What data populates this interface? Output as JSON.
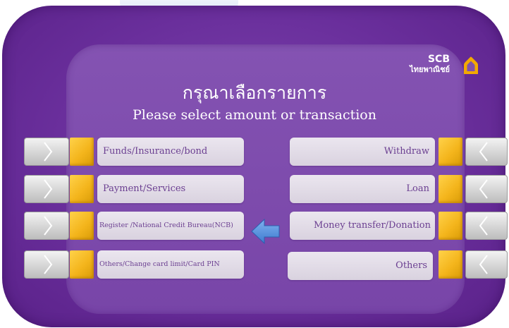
{
  "logo": {
    "brand": "SCB",
    "thai_name": "ไทยพาณิชย์",
    "icon": "scb-house-icon",
    "color": "#f2a900"
  },
  "header": {
    "title_th": "กรุณาเลือกรายการ",
    "title_en": "Please select amount or transaction"
  },
  "colors": {
    "frame": "#6a2f9c",
    "screen": "#7e4dae",
    "accent": "#f4b51c",
    "button_text": "#6b3f91"
  },
  "left_options": [
    {
      "label": "Funds/Insurance/bond"
    },
    {
      "label": "Payment/Services"
    },
    {
      "label": "Register /National Credit Bureau(NCB)"
    },
    {
      "label": "Others/Change card limit/Card PIN"
    }
  ],
  "right_options": [
    {
      "label": "Withdraw"
    },
    {
      "label": "Loan"
    },
    {
      "label": "Money transfer/Donation"
    },
    {
      "label": "Others"
    }
  ],
  "pointer": {
    "icon": "blue-left-arrow-icon",
    "points_to": "Register /National Credit Bureau(NCB)"
  }
}
